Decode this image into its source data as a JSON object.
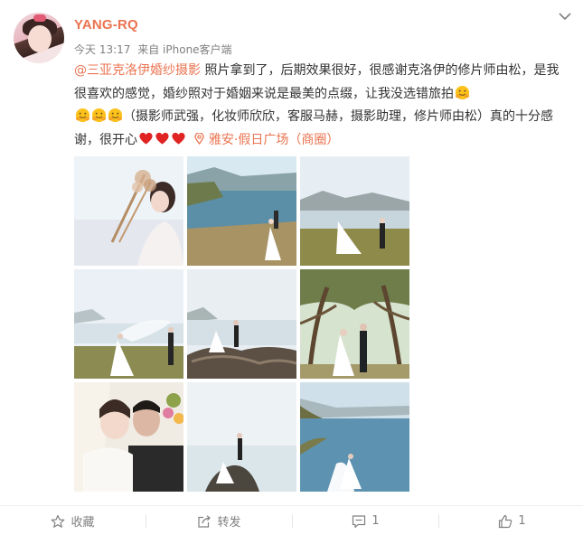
{
  "post": {
    "username": "YANG-RQ",
    "time": "今天 13:17",
    "source": "来自 iPhone客户端",
    "topic": "@三亚克洛伊婚纱摄影",
    "text_1": " 照片拿到了，后期效果很好，很感谢克洛伊的修片师由松，是我很喜欢的感觉，婚纱照对于婚姻来说是最美的点缀，让我没选错旅拍",
    "text_2": "（摄影师武强，化妆师欣欣，客服马赫，摄影助理，修片师由松）真的十分感谢，很开心",
    "location": "雅安·假日广场（商圈）",
    "emoji_hug": "hug-emoji",
    "emoji_heart": "red-heart-emoji"
  },
  "photos": [
    {
      "name": "photo-bride-bouquet"
    },
    {
      "name": "photo-lakeside-couple"
    },
    {
      "name": "photo-grass-veil"
    },
    {
      "name": "photo-veil-wind"
    },
    {
      "name": "photo-rocks-couple"
    },
    {
      "name": "photo-forest-couple"
    },
    {
      "name": "photo-kiss-closeup"
    },
    {
      "name": "photo-rock-lake"
    },
    {
      "name": "photo-shore-bride"
    }
  ],
  "actions": {
    "favorite": "收藏",
    "repost": "转发",
    "comment": "1",
    "like": "1"
  },
  "icons": {
    "more": "chevron-down-icon",
    "favorite": "star-icon",
    "repost": "share-icon",
    "comment": "comment-icon",
    "like": "thumbs-up-icon",
    "location": "location-pin-icon"
  },
  "colors": {
    "accent": "#eb7350",
    "text": "#333333",
    "muted": "#808080"
  }
}
